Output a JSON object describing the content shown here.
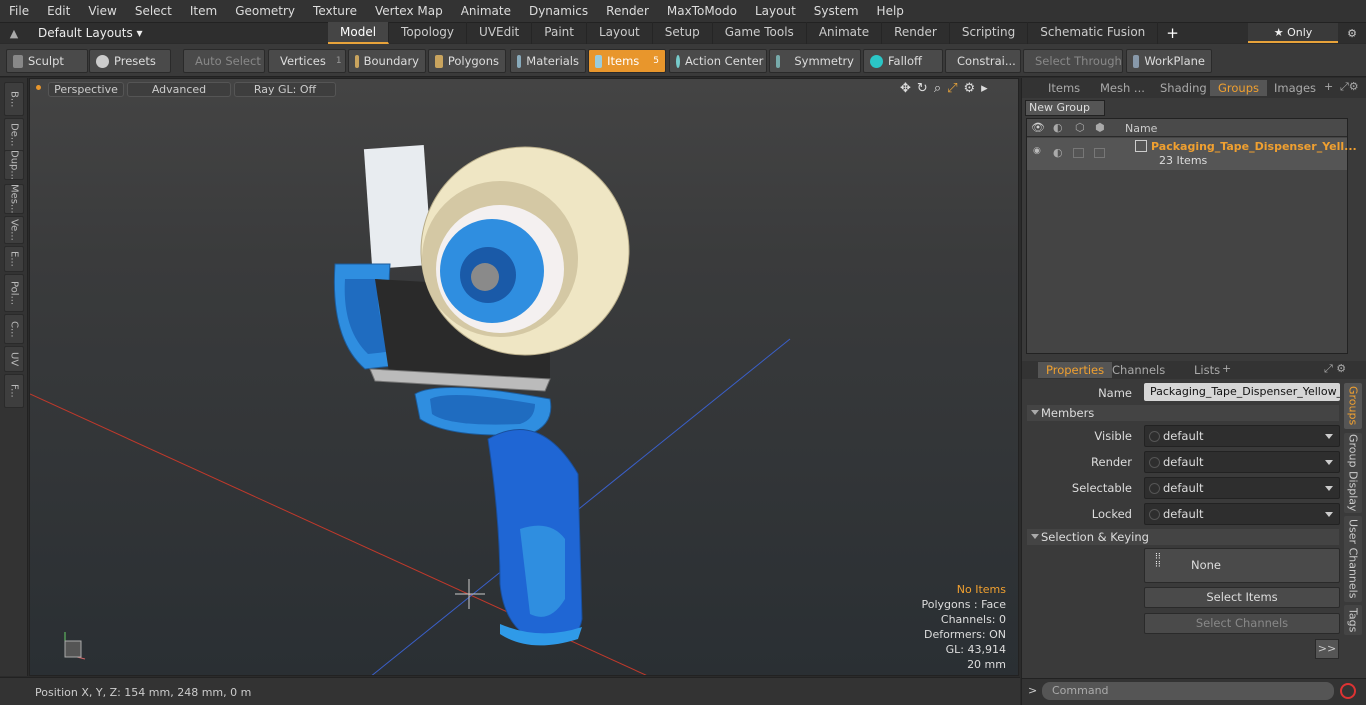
{
  "menu": [
    "File",
    "Edit",
    "View",
    "Select",
    "Item",
    "Geometry",
    "Texture",
    "Vertex Map",
    "Animate",
    "Dynamics",
    "Render",
    "MaxToModo",
    "Layout",
    "System",
    "Help"
  ],
  "layout_selector": "Default Layouts",
  "top_tabs": [
    "Model",
    "Topology",
    "UVEdit",
    "Paint",
    "Layout",
    "Setup",
    "Game Tools",
    "Animate",
    "Render",
    "Scripting",
    "Schematic Fusion"
  ],
  "only_label": "Only",
  "toolbar": {
    "sculpt": "Sculpt",
    "presets": "Presets",
    "auto_select": "Auto Select",
    "vertices": "Vertices",
    "vertices_count": "1",
    "boundary": "Boundary",
    "polygons": "Polygons",
    "materials": "Materials",
    "items": "Items",
    "items_count": "5",
    "action_center": "Action Center",
    "symmetry": "Symmetry",
    "falloff": "Falloff",
    "constraints": "Constrai...",
    "select_through": "Select Through",
    "workplane": "WorkPlane"
  },
  "left_tabs": [
    "B...",
    "De...",
    "Dup...",
    "Mes...",
    "Ve...",
    "E...",
    "Pol...",
    "C...",
    "UV",
    "F..."
  ],
  "viewport": {
    "view": "Perspective",
    "shading": "Advanced",
    "raygl": "Ray GL: Off",
    "stats": {
      "no_items": "No Items",
      "polygons": "Polygons : Face",
      "channels": "Channels: 0",
      "deformers": "Deformers: ON",
      "gl": "GL: 43,914",
      "scale": "20 mm"
    }
  },
  "status": "Position X, Y, Z:   154 mm, 248 mm, 0 m",
  "right_top_tabs": [
    "Items",
    "Mesh ...",
    "Shading",
    "Groups",
    "Images"
  ],
  "new_group": "New Group",
  "list_header": "Name",
  "group": {
    "name": "Packaging_Tape_Dispenser_Yell...",
    "count": "23 Items"
  },
  "prop_tabs": [
    "Properties",
    "Channels",
    "Lists"
  ],
  "props": {
    "name_label": "Name",
    "name_value": "Packaging_Tape_Dispenser_Yellow_La",
    "members": "Members",
    "visible": "Visible",
    "render": "Render",
    "selectable": "Selectable",
    "locked": "Locked",
    "default": "default",
    "sel_keying": "Selection & Keying",
    "none": "None",
    "select_items": "Select Items",
    "select_channels": "Select Channels",
    "more": ">>"
  },
  "side_tabs": [
    "Groups",
    "Group Display",
    "User Channels",
    "Tags"
  ],
  "command": "Command",
  "colors": {
    "accent": "#e8962c",
    "blue": "#2f7fd8",
    "tape": "#efe6c4"
  }
}
